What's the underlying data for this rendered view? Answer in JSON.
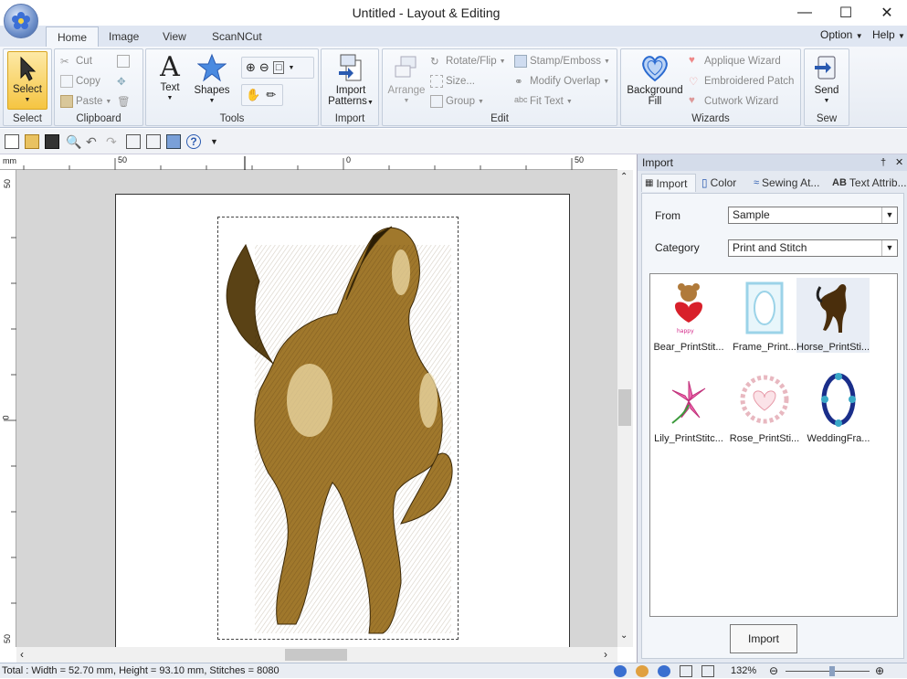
{
  "window": {
    "title": "Untitled - Layout & Editing"
  },
  "tabs": [
    "Home",
    "Image",
    "View",
    "ScanNCut"
  ],
  "right_menu": {
    "option": "Option",
    "help": "Help"
  },
  "ribbon": {
    "select": {
      "button": "Select",
      "group": "Select"
    },
    "clipboard": {
      "cut": "Cut",
      "copy": "Copy",
      "paste": "Paste",
      "group": "Clipboard"
    },
    "tools": {
      "text": "Text",
      "shapes": "Shapes",
      "group": "Tools"
    },
    "import": {
      "line1": "Import",
      "line2": "Patterns",
      "group": "Import"
    },
    "edit": {
      "arrange": "Arrange",
      "rotate": "Rotate/Flip",
      "size": "Size...",
      "group_btn": "Group",
      "stamp": "Stamp/Emboss",
      "overlap": "Modify Overlap",
      "fit_text": "Fit Text",
      "group": "Edit"
    },
    "wizards": {
      "bg_line1": "Background",
      "bg_line2": "Fill",
      "applique": "Applique Wizard",
      "patch": "Embroidered Patch",
      "cutwork": "Cutwork Wizard",
      "group": "Wizards"
    },
    "sew": {
      "send": "Send",
      "group": "Sew"
    }
  },
  "ruler": {
    "unit": "mm",
    "h_labels": [
      "50",
      "0",
      "50"
    ],
    "v_labels": [
      "50",
      "0",
      "50"
    ]
  },
  "panel": {
    "title": "Import",
    "tabs": [
      "Import",
      "Color",
      "Sewing At...",
      "Text Attrib..."
    ],
    "from_label": "From",
    "from_value": "Sample",
    "category_label": "Category",
    "category_value": "Print and Stitch",
    "items": [
      "Bear_PrintStit...",
      "Frame_Print...",
      "Horse_PrintSti...",
      "Lily_PrintStitc...",
      "Rose_PrintSti...",
      "WeddingFra..."
    ],
    "import_button": "Import"
  },
  "status": {
    "text": "Total : Width = 52.70 mm, Height = 93.10 mm, Stitches = 8080",
    "zoom": "132%"
  },
  "colors": {
    "accent": "#f5c542",
    "ribbon": "#e6ebf3",
    "canvas": "#d6d6d6",
    "horse": "#a0782c"
  }
}
